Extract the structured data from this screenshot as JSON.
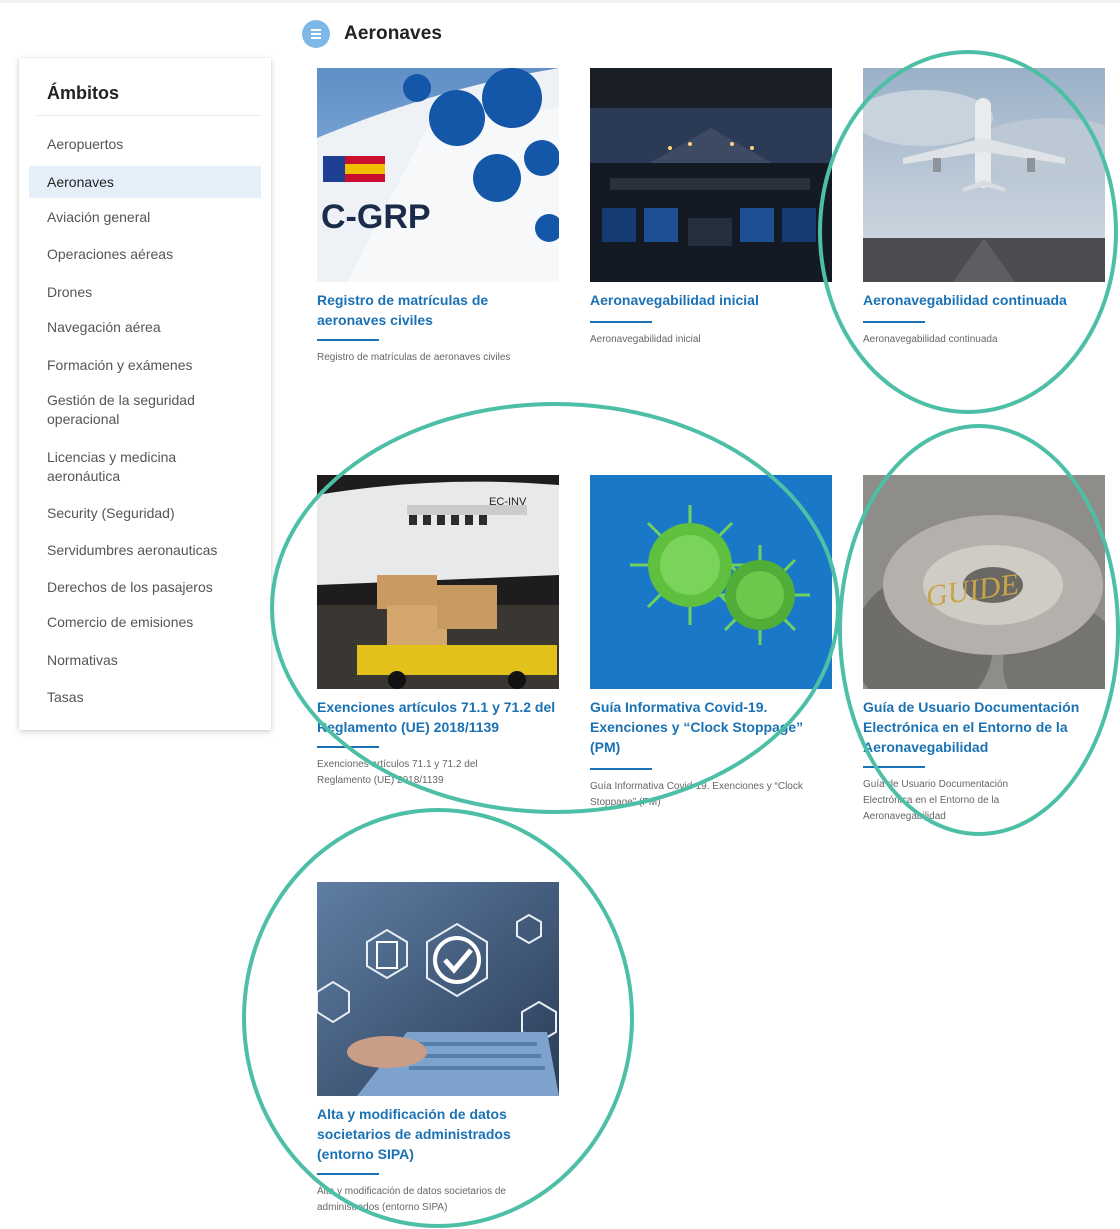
{
  "page": {
    "title": "Aeronaves"
  },
  "sidebar": {
    "title": "Ámbitos",
    "items": [
      {
        "label": "Aeropuertos"
      },
      {
        "label": "Aeronaves"
      },
      {
        "label": "Aviación general"
      },
      {
        "label": "Operaciones aéreas"
      },
      {
        "label": "Drones"
      },
      {
        "label": "Navegación aérea"
      },
      {
        "label": "Formación y exámenes"
      },
      {
        "label": "Gestión de la seguridad operacional"
      },
      {
        "label": "Licencias y medicina aeronáutica"
      },
      {
        "label": "Security (Seguridad)"
      },
      {
        "label": "Servidumbres aeronauticas"
      },
      {
        "label": "Derechos de los pasajeros"
      },
      {
        "label": "Comercio de emisiones"
      },
      {
        "label": "Normativas"
      },
      {
        "label": "Tasas"
      }
    ],
    "active_index": 1
  },
  "cards": [
    {
      "title": "Registro de matrículas de aeronaves civiles",
      "desc": "Registro de matrículas de aeronaves civiles",
      "image_label": "C-GRP"
    },
    {
      "title": "Aeronavegabilidad inicial",
      "desc": "Aeronavegabilidad inicial"
    },
    {
      "title": "Aeronavegabilidad continuada",
      "desc": "Aeronavegabilidad continuada"
    },
    {
      "title": "Exenciones artículos 71.1 y 71.2 del Reglamento (UE) 2018/1139",
      "desc": "Exenciones artículos 71.1 y 71.2 del Reglamento (UE) 2018/1139",
      "image_label": "EC-INV"
    },
    {
      "title": "Guía Informativa Covid-19. Exenciones y “Clock Stoppage” (PM)",
      "desc": "Guía Informativa Covid-19. Exenciones y “Clock Stoppage” (PM)"
    },
    {
      "title": "Guía de Usuario Documentación Electrónica en el Entorno de la Aeronavegabilidad",
      "desc": "Guía de Usuario Documentación Electrónica en el Entorno de la Aeronavegabilidad",
      "image_label": "GUIDE"
    },
    {
      "title": "Alta y modificación de datos societarios de administrados (entorno SIPA)",
      "desc": "Alta y modificación de datos societarios de administrados (entorno SIPA)"
    }
  ],
  "colors": {
    "accent": "#1a72b5",
    "highlight_ring": "#4cbfa6",
    "active_bg": "#e4eff9"
  }
}
